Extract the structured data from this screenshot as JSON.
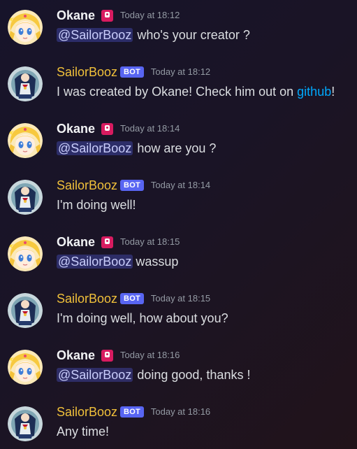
{
  "users": {
    "okane": {
      "name": "Okane",
      "avatar_icon": "sailor-moon-avatar",
      "role_icon": "pink-role-icon"
    },
    "bot": {
      "name": "SailorBooz",
      "tag": "BOT",
      "avatar_icon": "sailor-scout-avatar"
    }
  },
  "colors": {
    "bot_name": "#f0c03a",
    "user_name": "#f2f3f5",
    "bot_tag": "#5865f2",
    "mention_bg": "#4f5596",
    "link": "#00a8fc",
    "role_icon": "#d81b60"
  },
  "messages": [
    {
      "author": "Okane",
      "timestamp": "Today at 18:12",
      "mention": "@SailorBooz",
      "text": "who's your creator ?"
    },
    {
      "author": "SailorBooz",
      "tag": "BOT",
      "timestamp": "Today at 18:12",
      "text": "I was created by Okane! Check him out on ",
      "link": "github",
      "after": "!"
    },
    {
      "author": "Okane",
      "timestamp": "Today at 18:14",
      "mention": "@SailorBooz",
      "text": "how are you ?"
    },
    {
      "author": "SailorBooz",
      "tag": "BOT",
      "timestamp": "Today at 18:14",
      "text": "I'm doing well!"
    },
    {
      "author": "Okane",
      "timestamp": "Today at 18:15",
      "mention": "@SailorBooz",
      "text": "wassup"
    },
    {
      "author": "SailorBooz",
      "tag": "BOT",
      "timestamp": "Today at 18:15",
      "text": "I'm doing well, how about you?"
    },
    {
      "author": "Okane",
      "timestamp": "Today at 18:16",
      "mention": "@SailorBooz",
      "text": "doing good, thanks !"
    },
    {
      "author": "SailorBooz",
      "tag": "BOT",
      "timestamp": "Today at 18:16",
      "text": "Any time!"
    }
  ]
}
